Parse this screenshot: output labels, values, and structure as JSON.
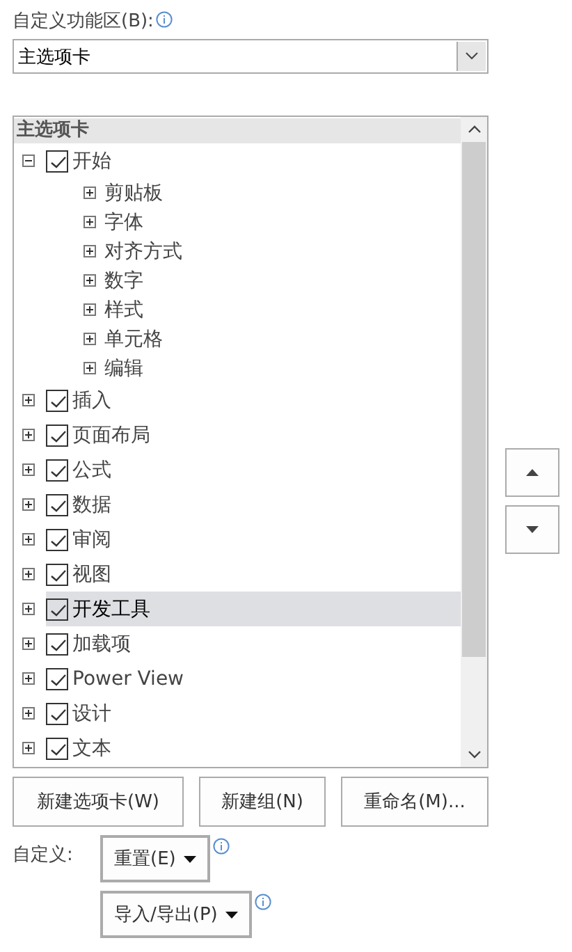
{
  "ribbon_label": "自定义功能区(B):",
  "ribbon_dropdown": {
    "value": "主选项卡"
  },
  "tree": {
    "header": "主选项卡",
    "items": [
      {
        "label": "开始",
        "checked": true,
        "expanded": true,
        "selected": false,
        "children": [
          {
            "label": "剪贴板"
          },
          {
            "label": "字体"
          },
          {
            "label": "对齐方式"
          },
          {
            "label": "数字"
          },
          {
            "label": "样式"
          },
          {
            "label": "单元格"
          },
          {
            "label": "编辑"
          }
        ]
      },
      {
        "label": "插入",
        "checked": true,
        "expanded": false,
        "selected": false
      },
      {
        "label": "页面布局",
        "checked": true,
        "expanded": false,
        "selected": false
      },
      {
        "label": "公式",
        "checked": true,
        "expanded": false,
        "selected": false
      },
      {
        "label": "数据",
        "checked": true,
        "expanded": false,
        "selected": false
      },
      {
        "label": "审阅",
        "checked": true,
        "expanded": false,
        "selected": false
      },
      {
        "label": "视图",
        "checked": true,
        "expanded": false,
        "selected": false
      },
      {
        "label": "开发工具",
        "checked": true,
        "expanded": false,
        "selected": true
      },
      {
        "label": "加载项",
        "checked": true,
        "expanded": false,
        "selected": false
      },
      {
        "label": "Power View",
        "checked": true,
        "expanded": false,
        "selected": false
      },
      {
        "label": "设计",
        "checked": true,
        "expanded": false,
        "selected": false
      },
      {
        "label": "文本",
        "checked": true,
        "expanded": false,
        "selected": false
      }
    ]
  },
  "buttons": [
    "新建选项卡(W)",
    "新建组(N)",
    "重命名(M)..."
  ],
  "customize_label": "自定义:",
  "reset_button": "重置(E)",
  "import_export_button": "导入/导出(P)"
}
